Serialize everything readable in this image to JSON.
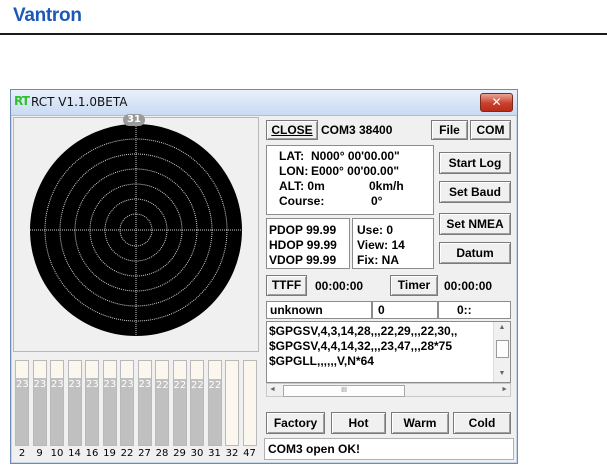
{
  "brand": "Vantron",
  "window": {
    "icon_text": "RT",
    "title": "RCT V1.1.0BETA",
    "close_glyph": "✕"
  },
  "sky": {
    "sat_label": "31"
  },
  "snr": [
    {
      "id": "2",
      "value": "23",
      "level": 0.8
    },
    {
      "id": "9",
      "value": "23",
      "level": 0.8
    },
    {
      "id": "10",
      "value": "23",
      "level": 0.8
    },
    {
      "id": "14",
      "value": "23",
      "level": 0.8
    },
    {
      "id": "16",
      "value": "23",
      "level": 0.8
    },
    {
      "id": "19",
      "value": "23",
      "level": 0.8
    },
    {
      "id": "22",
      "value": "23",
      "level": 0.8
    },
    {
      "id": "27",
      "value": "23",
      "level": 0.8
    },
    {
      "id": "28",
      "value": "22",
      "level": 0.78
    },
    {
      "id": "29",
      "value": "22",
      "level": 0.78
    },
    {
      "id": "30",
      "value": "22",
      "level": 0.78
    },
    {
      "id": "31",
      "value": "22",
      "level": 0.78
    },
    {
      "id": "32",
      "value": "",
      "level": 0
    },
    {
      "id": "47",
      "value": "",
      "level": 0
    }
  ],
  "toolbar": {
    "close_port": "CLOSE",
    "port_status": "COM3 38400",
    "file": "File",
    "com": "COM"
  },
  "position": {
    "lat_label": "LAT:",
    "lat_value": "N000° 00'00.00\"",
    "lon_label": "LON:",
    "lon_value": "E000° 00'00.00\"",
    "alt_label": "ALT: 0m",
    "speed": "0km/h",
    "course_label": "Course:",
    "course_value": "0°"
  },
  "buttons": {
    "start_log": "Start Log",
    "set_baud": "Set Baud",
    "set_nmea": "Set NMEA",
    "datum": "Datum",
    "ttff": "TTFF",
    "timer": "Timer",
    "factory": "Factory",
    "hot": "Hot",
    "warm": "Warm",
    "cold": "Cold"
  },
  "dop": {
    "pdop": "PDOP 99.99",
    "hdop": "HDOP 99.99",
    "vdop": "VDOP 99.99",
    "use": "Use:  0",
    "view": "View: 14",
    "fix": "Fix: NA"
  },
  "ttff_value": "00:00:00",
  "timer_value": "00:00:00",
  "status_row": {
    "state": "unknown",
    "count": "0",
    "time": "0::"
  },
  "nmea_lines": [
    "$GPGSV,4,3,14,28,,,22,29,,,22,30,,",
    "$GPGSV,4,4,14,32,,,23,47,,,28*75",
    "$GPGLL,,,,,,V,N*64"
  ],
  "scroll_glyphs": {
    "up": "▲",
    "down": "▼",
    "left": "◄",
    "right": "►",
    "grip": "III"
  },
  "statusbar": "COM3 open OK!"
}
